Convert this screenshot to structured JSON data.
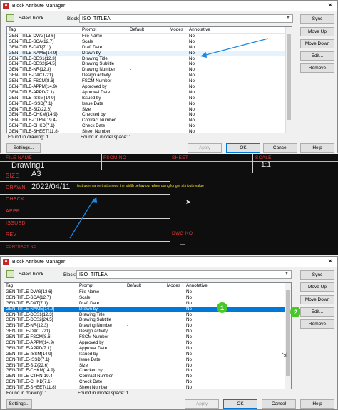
{
  "dialog": {
    "title": "Block Attribute Manager",
    "select_block_label": "Select block",
    "block_label": "Block:",
    "block_value": "ISO_TITLEA",
    "columns": [
      "Tag",
      "Prompt",
      "Default",
      "Modes",
      "Annotative"
    ],
    "rows": [
      {
        "tag": "GEN-TITLE-DWG{13.6}",
        "prompt": "File Name",
        "default": "",
        "modes": "",
        "annotative": "No"
      },
      {
        "tag": "GEN-TITLE-SCA{12.7}",
        "prompt": "Scale",
        "default": "",
        "modes": "",
        "annotative": "No"
      },
      {
        "tag": "GEN-TITLE-DAT{7.1}",
        "prompt": "Draft Date",
        "default": "",
        "modes": "",
        "annotative": "No"
      },
      {
        "tag": "GEN-TITLE-NAME{14.9}",
        "prompt": "Drawn by",
        "default": "",
        "modes": "",
        "annotative": "No"
      },
      {
        "tag": "GEN-TITLE-DES1{12.3}",
        "prompt": "Drawing Title",
        "default": "",
        "modes": "",
        "annotative": "No"
      },
      {
        "tag": "GEN-TITLE-DES2{24.5}",
        "prompt": "Drawing Subtitle",
        "default": "",
        "modes": "",
        "annotative": "No"
      },
      {
        "tag": "GEN-TITLE-NR{12.3}",
        "prompt": "Drawing Number",
        "default": "-",
        "modes": "",
        "annotative": "No"
      },
      {
        "tag": "GEN-TITLE-DACT{21}",
        "prompt": "Design activity",
        "default": "",
        "modes": "",
        "annotative": "No"
      },
      {
        "tag": "GEN-TITLE-FSCM{8.6}",
        "prompt": "FSCM Number",
        "default": "",
        "modes": "",
        "annotative": "No"
      },
      {
        "tag": "GEN-TITLE-APPM{14.9}",
        "prompt": "Approved by",
        "default": "",
        "modes": "",
        "annotative": "No"
      },
      {
        "tag": "GEN-TITLE-APPD{7.1}",
        "prompt": "Approval Date",
        "default": "",
        "modes": "",
        "annotative": "No"
      },
      {
        "tag": "GEN-TITLE-ISSM{14.9}",
        "prompt": "Issued by",
        "default": "",
        "modes": "",
        "annotative": "No"
      },
      {
        "tag": "GEN-TITLE-ISSD{7.1}",
        "prompt": "Issue Date",
        "default": "",
        "modes": "",
        "annotative": "No"
      },
      {
        "tag": "GEN-TITLE-SIZ{22.6}",
        "prompt": "Size",
        "default": "",
        "modes": "",
        "annotative": "No"
      },
      {
        "tag": "GEN-TITLE-CHKM{14.9}",
        "prompt": "Checked by",
        "default": "",
        "modes": "",
        "annotative": "No"
      },
      {
        "tag": "GEN-TITLE-CTRN{19.4}",
        "prompt": "Contract Number",
        "default": "",
        "modes": "",
        "annotative": "No"
      },
      {
        "tag": "GEN-TITLE-CHKD{7.1}",
        "prompt": "Check Date",
        "default": "",
        "modes": "",
        "annotative": "No"
      },
      {
        "tag": "GEN-TITLE-SHEET{11.8}",
        "prompt": "Sheet Number",
        "default": "",
        "modes": "",
        "annotative": "No"
      }
    ],
    "buttons": {
      "sync": "Sync",
      "move_up": "Move Up",
      "move_down": "Move Down",
      "edit": "Edit...",
      "remove": "Remove",
      "settings": "Settings...",
      "apply": "Apply",
      "ok": "OK",
      "cancel": "Cancel",
      "help": "Help"
    },
    "found_in_drawing": "Found in drawing: 1",
    "found_in_model_space": "Found in model space: 1"
  },
  "title_block": {
    "file_name_label": "FILE NAME",
    "file_name_value": "Drawing1",
    "fscm_label": "FSCM NO",
    "sheet_label": "SHEET",
    "scale_label": "SCALE",
    "scale_value": "1:1",
    "size_label": "SIZE",
    "size_value": "A3",
    "drawn_label": "DRAWN",
    "drawn_date": "2022/04/11",
    "drawn_name": "test user name that shows the width behaviour when using longer attribute value",
    "check_label": "CHECK",
    "appr_label": "APPR.",
    "issued_label": "ISSUED",
    "rev_label": "REV",
    "contract_label": "CONTRACT NO",
    "dwg_no_label": "DWG NO",
    "dwg_no_value": "—"
  },
  "annotations": {
    "badge_1": "1",
    "badge_2": "2",
    "arrow_color": "#1e88e5",
    "badge_color": "#48c728"
  },
  "colors": {
    "selection": "#0078d7",
    "hover_row": "#e5f3ff",
    "dwg_background": "#0e0e0e",
    "dwg_label": "#e23b3b"
  }
}
